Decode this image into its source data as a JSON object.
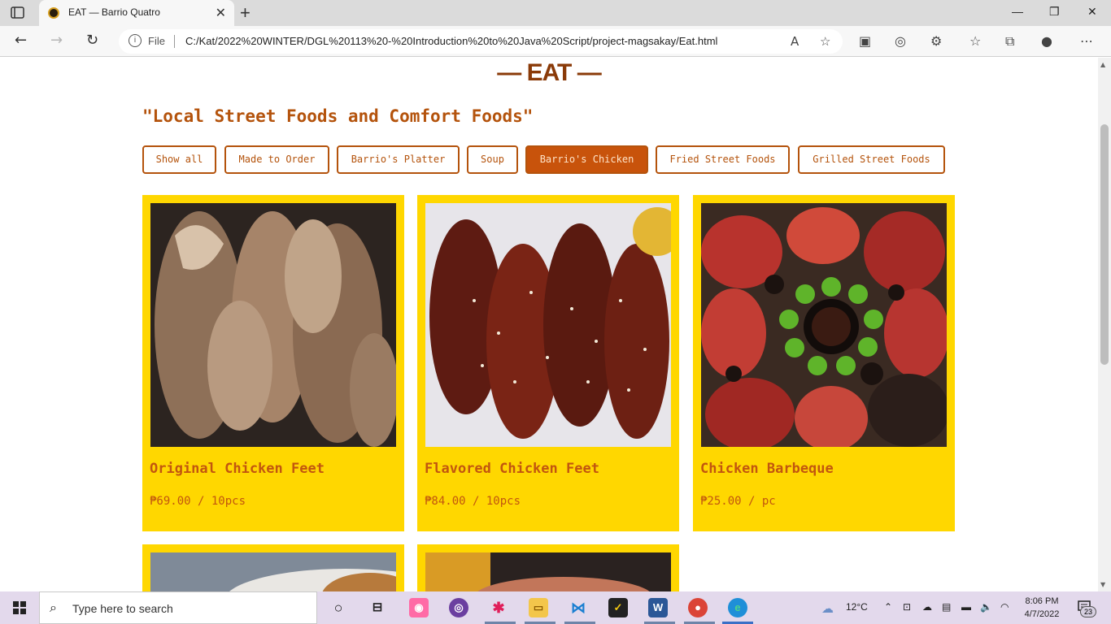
{
  "browser": {
    "tab_title": "EAT — Barrio Quatro",
    "protocol_label": "File",
    "url": "C:/Kat/2022%20WINTER/DGL%20113%20-%20Introduction%20to%20Java%20Script/project-magsakay/Eat.html"
  },
  "page": {
    "heading": "— EAT —",
    "subtitle": "\"Local Street Foods and Comfort Foods\"",
    "filters": [
      {
        "label": "Show all",
        "active": false
      },
      {
        "label": "Made to Order",
        "active": false
      },
      {
        "label": "Barrio's Platter",
        "active": false
      },
      {
        "label": "Soup",
        "active": false
      },
      {
        "label": "Barrio's Chicken",
        "active": true
      },
      {
        "label": "Fried Street Foods",
        "active": false
      },
      {
        "label": "Grilled Street Foods",
        "active": false
      }
    ],
    "items": [
      {
        "name": "Original Chicken Feet",
        "price": "₱69.00 / 10pcs"
      },
      {
        "name": "Flavored Chicken Feet",
        "price": "₱84.00 / 10pcs"
      },
      {
        "name": "Chicken Barbeque",
        "price": "₱25.00 / pc"
      }
    ]
  },
  "taskbar": {
    "search_placeholder": "Type here to search",
    "weather": "12°C",
    "time": "8:06 PM",
    "date": "4/7/2022",
    "notification_count": "23"
  },
  "colors": {
    "accent": "#b4530c",
    "active_filter": "#c8530b",
    "card_bg": "#ffd700",
    "heading": "#8a3a08"
  }
}
